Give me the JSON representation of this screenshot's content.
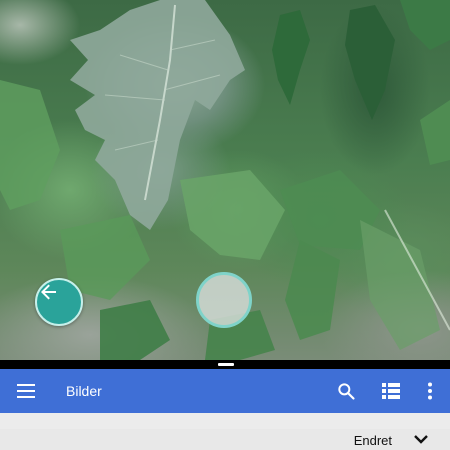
{
  "app_bar": {
    "title": "Bilder",
    "menu_icon": "hamburger-menu-icon",
    "actions": [
      "search-icon",
      "list-view-icon",
      "more-vert-icon"
    ],
    "color": "#3f6fd6"
  },
  "camera": {
    "back_icon": "arrow-left-icon",
    "accent": "#2aa39a"
  },
  "sort": {
    "label": "Endret",
    "icon": "chevron-down-icon"
  }
}
